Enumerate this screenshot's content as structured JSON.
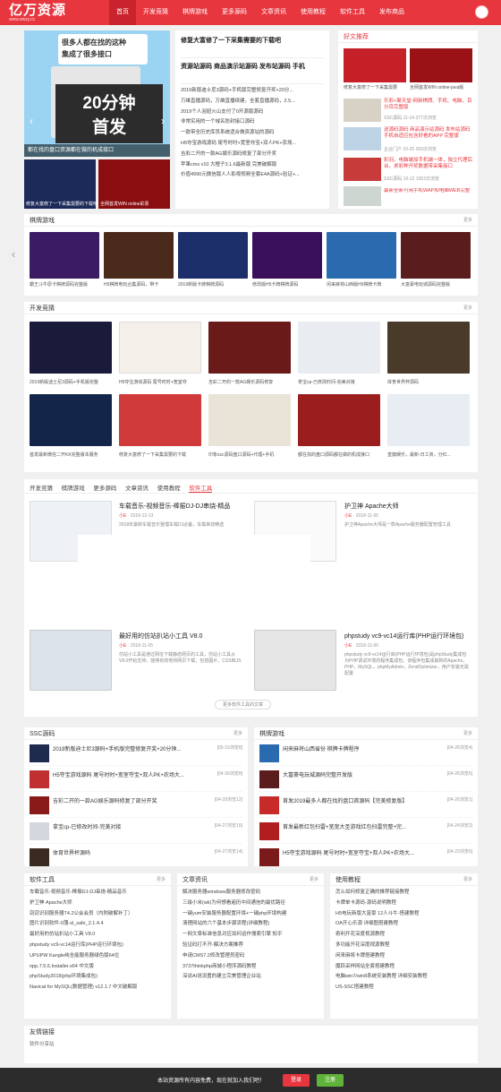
{
  "brand": {
    "name": "亿万资源",
    "url": "www.ewzy.cc"
  },
  "nav": [
    "首页",
    "开发竞猜",
    "棋牌游戏",
    "更多源码",
    "文章资讯",
    "使用教程",
    "软件工具",
    "发布商品"
  ],
  "hero": {
    "banner_line1": "很多人都在找的这种",
    "banner_line2": "集成了很多接口",
    "big1": "20分钟",
    "big2": "首发",
    "caption": "都在找的盘口资源都在做的机成接口",
    "side_caps": [
      "修复大富修了一下采集需要的下载吧",
      "全网首发WIN online彩票"
    ]
  },
  "headline": {
    "title1": "修复大富修了一下采集需要的下载吧",
    "title2": "资源站源码 商品演示站源码 发布站源码 手机",
    "items": [
      "2019新版迪士尼3源码+手机版完整修复开奖+20分...",
      "万维直播源码，万维直播续建，全套直播源码，2.5...",
      "2019个人泡妞火山支付了0开源版源码",
      "非常实用的一个域名防封接口源码",
      "一款带全历史库员系统适合做资源站的源码",
      "H5夺宝游戏源码 尾号时时+宽室夺宝+双人PK+农场...",
      "吉彩二开的一款AG娱乐源码修复了部分开奖",
      "苹果cms v10 大橙子3.1.6最新版 完美破解版",
      "价值4990元微信版人人影视视频全套E4A源码+验证+..."
    ]
  },
  "recommend": {
    "title": "好文推荐",
    "tops": [
      "修复大富修了一下采集需要",
      "全网首发WIN online-java版"
    ],
    "items": [
      {
        "t": "乐彩+聚天堂-网新棋牌、手机、电脑，百分百完整版",
        "m": "SSC源码  11-14  377次浏览"
      },
      {
        "t": "送源码源码 商品演示站源码 发布站源码 手机自适应包含好看的APP 完整版",
        "m": "企业门户  10-25  309次浏览"
      },
      {
        "t": "彩羽，电脑端加手机端一体，独立代理后台，求彩种开奖数据带采集接口",
        "m": "SSC源码  10-12  1053次浏览"
      },
      {
        "t": "最新全新可用手机WAP和电脑WEB完整",
        "m": ""
      }
    ]
  },
  "qipai": {
    "title": "棋牌游戏",
    "more": "更多",
    "caps": [
      "霸王斗牛原卡棋牌源码完整版",
      "H5棋牌电玩合集源码，带卡",
      "2019新版卡牌棋牌源码",
      "修改版H5卡牌棋牌源码",
      "闲来麻将山西版H5棋牌卡牌",
      "大富豪电玩城源码完整版"
    ]
  },
  "kaifa": {
    "title": "开发竞猜",
    "more": "更多",
    "caps1": [
      "2019新版迪士尼3源码+手机版完整",
      "H5夺宝游戏源码 尾号时时+宽室夺",
      "吉彩二开的一款AG娱乐源码修复",
      "拿宝cp-已修改时间-完美对接",
      "体育世界杯源码"
    ],
    "caps2": [
      "首发最新微信二开KK完整版本服务",
      "修复大富修了一下采集需要的下载",
      "印象ssc源码盘口源码+代理+手机",
      "都在找的盘口源码都在做的机成接口",
      "皇旗娱乐，最新-日工资，分红..."
    ]
  },
  "tabs": {
    "items": [
      "开发竞猜",
      "棋牌游戏",
      "更多源码",
      "文章资讯",
      "使用教程",
      "软件工具"
    ],
    "active": "软件工具",
    "more": "更多软件工具的文章"
  },
  "posts": [
    {
      "title": "车载音乐-视频音乐-棒振DJ-DJ串烧-精品",
      "author": "小E",
      "date": "2018-12-13",
      "desc": "2018年最新车载音乐整理车载DJ必备，车载串烧精选"
    },
    {
      "title": "护卫神 Apache大师",
      "author": "小E",
      "date": "2018-11-05",
      "desc": "护卫神Apache大师是一款Apache服务器配置管理工具"
    },
    {
      "title": "最好用的仿站扒站小工具 V8.0",
      "author": "小E",
      "date": "2018-11-05",
      "desc": "仿站小工具是通过网址下载静态网页的工具，仿站小工具从V8.0开始支持，能够有效地将网页下载，包括图片，CSS和JS"
    },
    {
      "title": "phpstudy vc9-vc14运行库(PHP运行环境包)",
      "author": "小E",
      "date": "2018-11-05",
      "desc": "phpstudy vc9-vc14运行库(PHP运行环境包)是phpStudy集成包为PHP调试环境的程序集成包，该程序包集成最新的Apache，PHP，MySQL，phpMyAdmin，ZendOptimizer，用户安装无需配置"
    }
  ],
  "ssc": {
    "title": "SSC源码",
    "more": "更多",
    "items": [
      {
        "t": "2019新版迪士尼3源码+手机版完整修复开奖+20分钟...",
        "d": "[05-15浏览8]"
      },
      {
        "t": "H5夺宝游戏源码 尾号时时+宽室夺宝+双人PK+农场大...",
        "d": "[04-30浏览8]"
      },
      {
        "t": "吉彩二开的一款AG娱乐源码修复了部分开奖",
        "d": "[04-29浏览12]"
      },
      {
        "t": "拿宝cp-已修改时间-完美对接",
        "d": "[04-27浏览15]"
      },
      {
        "t": "体育世界杯源码",
        "d": "[04-27浏览14]"
      }
    ]
  },
  "qp2": {
    "title": "棋牌游戏",
    "more": "更多",
    "items": [
      {
        "t": "闲来麻将山西省份 棋牌卡牌程序",
        "d": "[04-26浏览4]"
      },
      {
        "t": "大富豪电玩城源码完整开发版",
        "d": "[04-26浏览6]"
      },
      {
        "t": "首发2019最多人都在找的盘口首源码【完美修复版】",
        "d": "[04-26浏览1]"
      },
      {
        "t": "首发最新红包扫雷+宽宽大圣游戏红包扫雷完整+完...",
        "d": "[04-24浏览2]"
      },
      {
        "t": "H5夺宝游戏源码 尾号时时+宽室夺宝+双人PK+农场大...",
        "d": "[04-23浏览6]"
      }
    ]
  },
  "soft": {
    "title": "软件工具",
    "more": "更多",
    "items": [
      "车载音乐-视频音乐-棒振DJ-DJ串烧-精品音乐",
      "护卫神 Apache大师",
      "窃窃识别服务器T4.2公会会员（内附破解补丁）",
      "图片识别软件-0蒲-sl_safe_2.1.4.4",
      "最好用的仿站扒站小工具 V8.0",
      "phpstudy vc9-vc14运行库(PHP运行环境包)",
      "UPUPW Kangle纯全能服务器绿色版64位",
      "npp.7.5.6.Installer.x64 中文版",
      "phpStudy2018(php环境集成包)",
      "Navicat for MySQL(数据管理) v12.1.7 中文破解版"
    ]
  },
  "news": {
    "title": "文章资讯",
    "more": "更多",
    "items": [
      "解决服务器windows服务器修改密码",
      "三级小米(wk)为何想看遍历中间通信的最优路径",
      "一键yum安装服务器配置环境+一键php环境构建",
      "清理网站的六个基本步骤流程(详细教程)",
      "一网文章标准信息对应如何运作搜索引擎 知乎",
      "验证码打不开-解决方案推荐",
      "申请CMS7.2修改管理员密码",
      "3737thinkphp商城小程序源码教程",
      "深谈AI说设置的建立完美管理企业站"
    ]
  },
  "tut": {
    "title": "使用教程",
    "more": "更多",
    "items": [
      "怎么如何修复正确的推荐链接教程",
      "卡牌单卡源码-源码说明教程",
      "H5电玩新版大富豪 12人斗牛-搭建教程",
      "OA开心乐源 详细图搭建教程",
      "奇利开花深度视源教程",
      "多功能开花深度视源教程",
      "闲来麻将卡牌搭建教程",
      "魔跃采样网站全套搭建教程",
      "电脑win7/win8系统安装教程 详细安装教程",
      "US-SSC搭建教程"
    ]
  },
  "friend": {
    "title": "友情链接",
    "items": [
      "软件分享站"
    ]
  },
  "bar": {
    "text": "本站资源所有内容免费，现在就加入我们吧！",
    "login": "登录",
    "register": "注册"
  },
  "colors": {
    "brand": "#e8363f",
    "green": "#5fb33a"
  }
}
